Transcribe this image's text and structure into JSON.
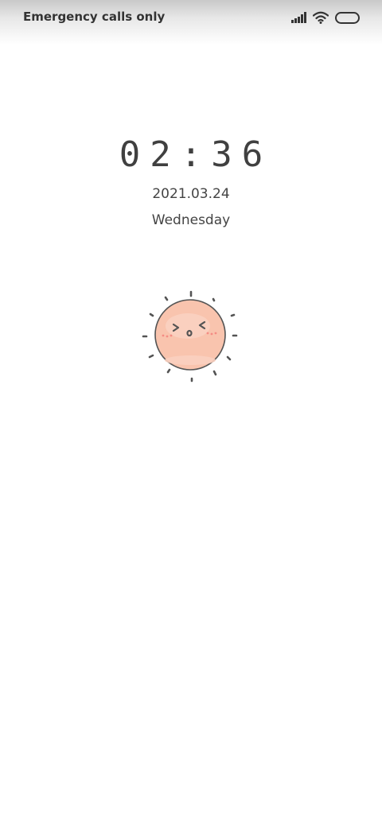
{
  "status_bar": {
    "carrier_text": "Emergency calls only",
    "icons": [
      "signal-icon",
      "wifi-icon",
      "battery-icon"
    ]
  },
  "lockscreen": {
    "time": "02:36",
    "date": "2021.03.24",
    "weekday": "Wednesday",
    "wallpaper_icon": "smiling-sun-icon"
  },
  "colors": {
    "sun_fill": "#f9c4ae",
    "sun_outline": "#545454",
    "text": "#404040",
    "background": "#ffffff"
  }
}
